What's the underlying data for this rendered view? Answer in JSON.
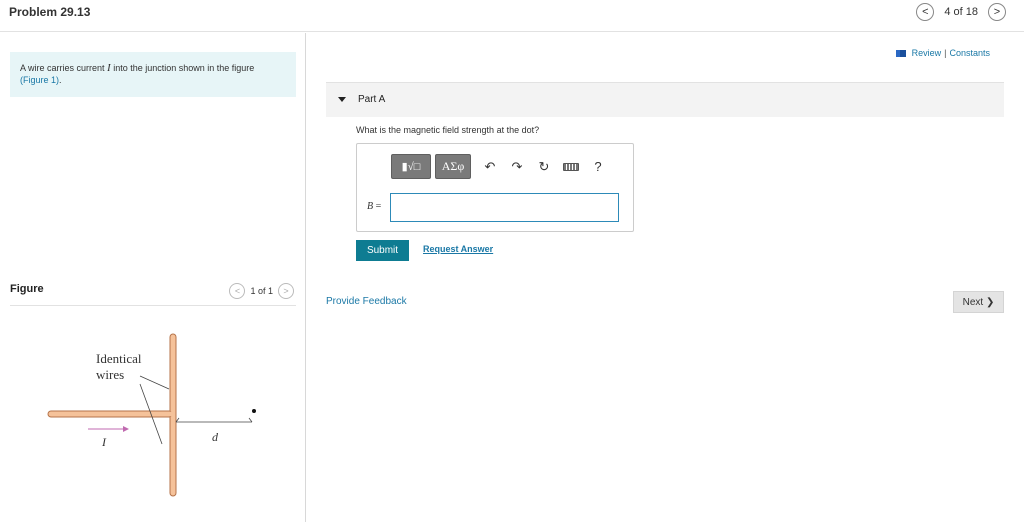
{
  "header": {
    "title": "Problem 29.13",
    "prev_symbol": "<",
    "counter": "4 of 18",
    "next_symbol": ">"
  },
  "intro": {
    "text_before": "A wire carries current ",
    "variable": "I",
    "text_after": " into the junction shown in the figure",
    "figure_link": "(Figure 1)",
    "trailing": "."
  },
  "figure": {
    "heading": "Figure",
    "counter": "1 of 1",
    "prev_symbol": "<",
    "next_symbol": ">",
    "label_identical": "Identical",
    "label_wires": "wires",
    "label_current": "I",
    "label_distance": "d"
  },
  "review": {
    "review_label": "Review",
    "separator": "|",
    "constants_label": "Constants"
  },
  "part": {
    "label": "Part A",
    "question": "What is the magnetic field strength at the dot?",
    "toolbar": {
      "math_label": "▮√□",
      "greek_label": "ΑΣφ",
      "undo_symbol": "↶",
      "redo_symbol": "↷",
      "reset_symbol": "↻",
      "help_symbol": "?"
    },
    "answer_variable": "B",
    "answer_equals": " =",
    "answer_value": "",
    "submit_label": "Submit",
    "request_label": "Request Answer"
  },
  "footer": {
    "feedback_label": "Provide Feedback",
    "next_label": "Next ❯"
  },
  "colors": {
    "accent": "#0e7c92",
    "link": "#1a78a6",
    "intro_bg": "#e7f5f7",
    "wire": "#f5c29a"
  }
}
